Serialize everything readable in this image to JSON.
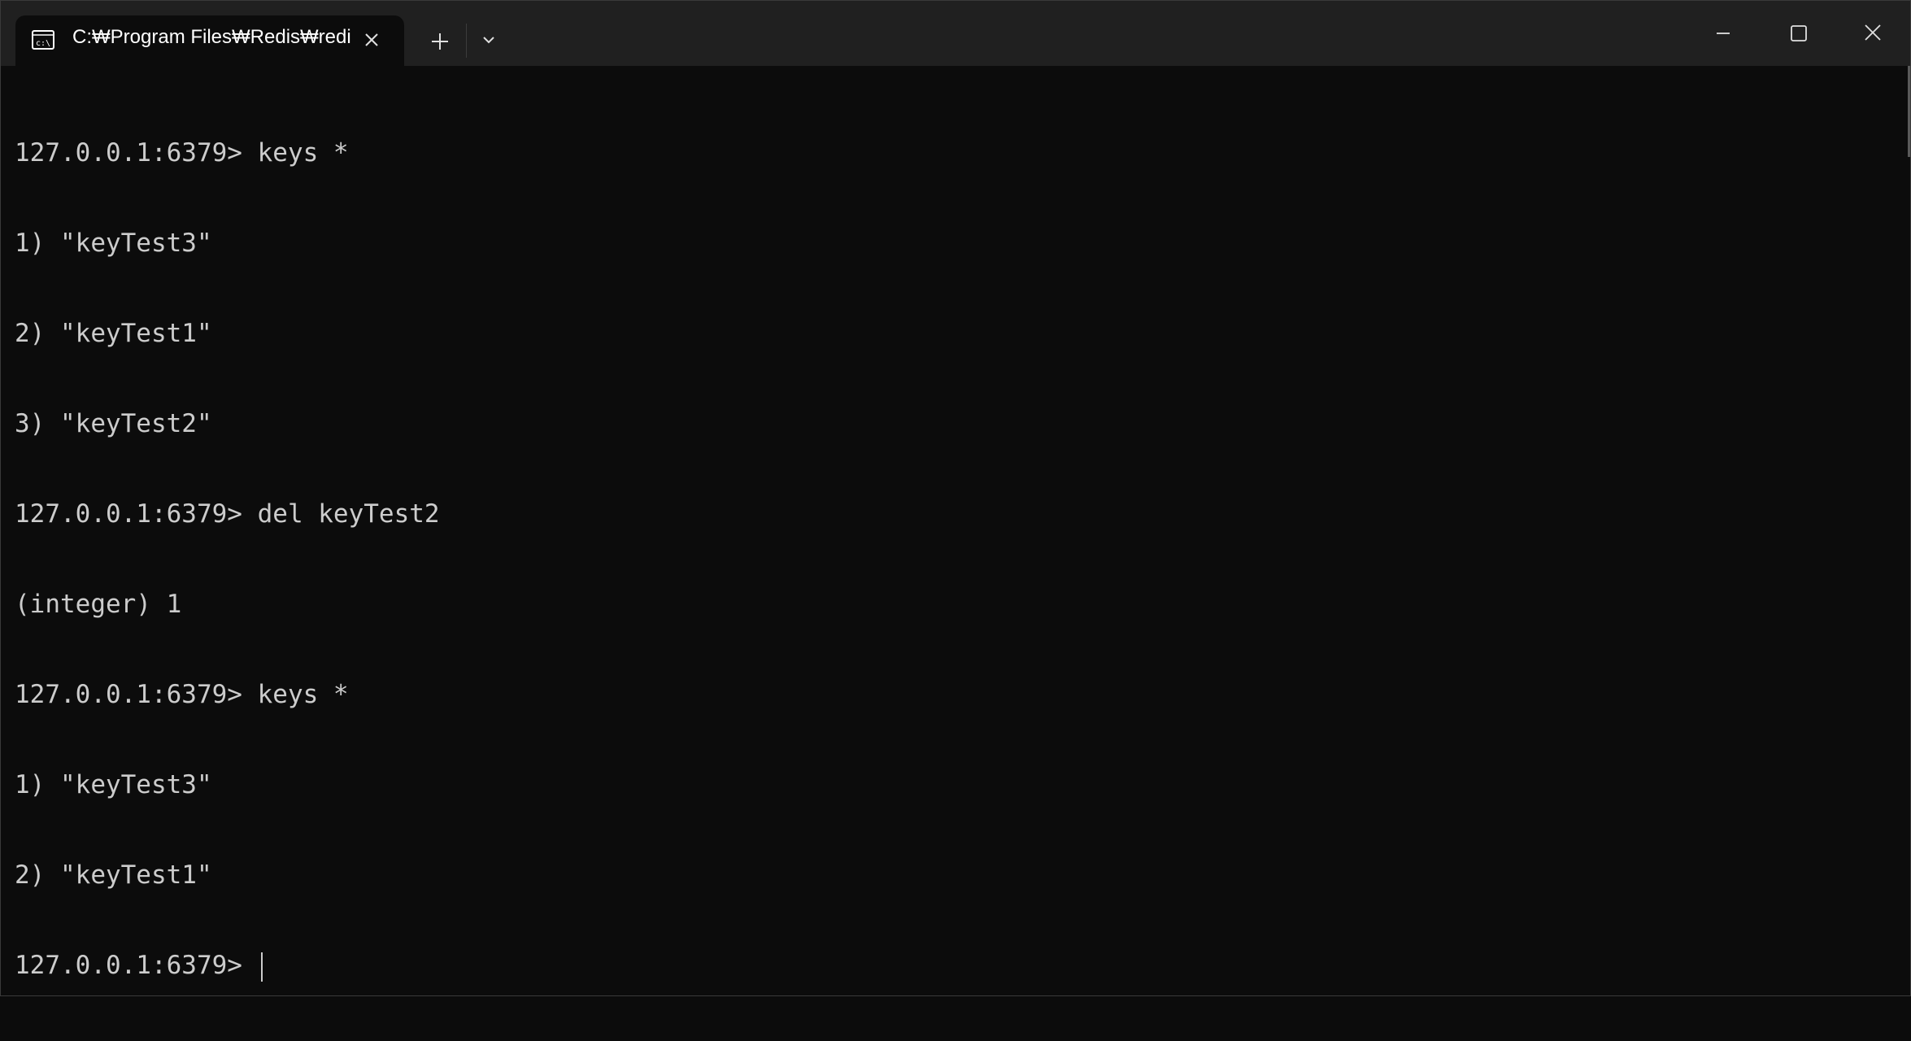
{
  "window": {
    "tab_title": "C:₩Program Files₩Redis₩redi"
  },
  "icons": {
    "tab": "command-prompt-icon",
    "close_tab": "close-icon",
    "new_tab": "plus-icon",
    "dropdown": "chevron-down-icon",
    "minimize": "minimize-icon",
    "maximize": "maximize-icon",
    "close_window": "close-icon"
  },
  "colors": {
    "background": "#0c0c0c",
    "titlebar": "#202020",
    "text": "#cccccc"
  },
  "terminal": {
    "lines": [
      "127.0.0.1:6379> keys *",
      "1) \"keyTest3\"",
      "2) \"keyTest1\"",
      "3) \"keyTest2\"",
      "127.0.0.1:6379> del keyTest2",
      "(integer) 1",
      "127.0.0.1:6379> keys *",
      "1) \"keyTest3\"",
      "2) \"keyTest1\"",
      "127.0.0.1:6379> "
    ]
  }
}
